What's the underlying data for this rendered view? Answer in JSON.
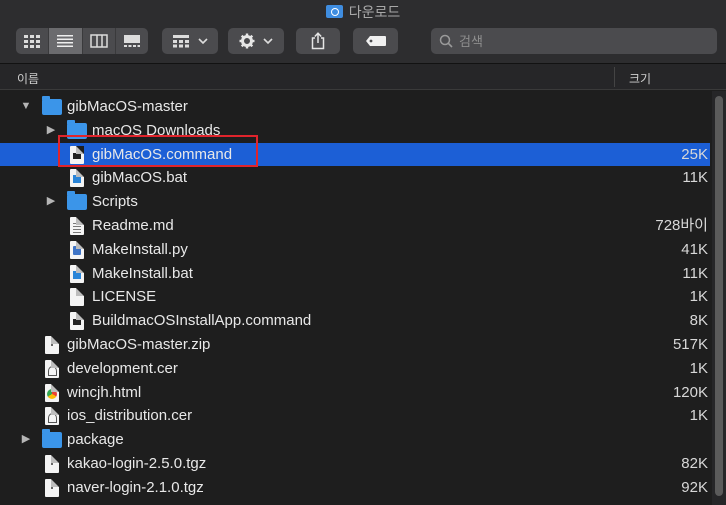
{
  "window": {
    "title": "다운로드",
    "title_icon": "downloads-folder-icon"
  },
  "toolbar": {
    "view_modes": [
      "icon-view-icon",
      "list-view-icon",
      "column-view-icon",
      "gallery-view-icon"
    ],
    "active_view": "list",
    "group_icon": "group-grid-icon",
    "action_icon": "gear-icon",
    "share_icon": "share-icon",
    "tag_icon": "tag-icon",
    "search_placeholder": "검색"
  },
  "columns": {
    "name": "이름",
    "size": "크기"
  },
  "accent_color": "#1c5fd6",
  "highlight_color": "#e0242c",
  "rows": [
    {
      "name": "gibMacOS-master",
      "size": "",
      "kind": "folder",
      "depth": 0,
      "disclosure": "expanded"
    },
    {
      "name": "macOS Downloads",
      "size": "",
      "kind": "folder",
      "depth": 1,
      "disclosure": "collapsed"
    },
    {
      "name": "gibMacOS.command",
      "size": "25K",
      "kind": "command",
      "depth": 1,
      "disclosure": "",
      "selected": true
    },
    {
      "name": "gibMacOS.bat",
      "size": "11K",
      "kind": "bat",
      "depth": 1,
      "disclosure": ""
    },
    {
      "name": "Scripts",
      "size": "",
      "kind": "folder",
      "depth": 1,
      "disclosure": "collapsed"
    },
    {
      "name": "Readme.md",
      "size": "728바이",
      "kind": "text",
      "depth": 1,
      "disclosure": ""
    },
    {
      "name": "MakeInstall.py",
      "size": "41K",
      "kind": "py",
      "depth": 1,
      "disclosure": ""
    },
    {
      "name": "MakeInstall.bat",
      "size": "11K",
      "kind": "bat",
      "depth": 1,
      "disclosure": ""
    },
    {
      "name": "LICENSE",
      "size": "1K",
      "kind": "doc",
      "depth": 1,
      "disclosure": ""
    },
    {
      "name": "BuildmacOSInstallApp.command",
      "size": "8K",
      "kind": "command",
      "depth": 1,
      "disclosure": ""
    },
    {
      "name": "gibMacOS-master.zip",
      "size": "517K",
      "kind": "zip",
      "depth": 0,
      "disclosure": ""
    },
    {
      "name": "development.cer",
      "size": "1K",
      "kind": "cer",
      "depth": 0,
      "disclosure": ""
    },
    {
      "name": "wincjh.html",
      "size": "120K",
      "kind": "html",
      "depth": 0,
      "disclosure": ""
    },
    {
      "name": "ios_distribution.cer",
      "size": "1K",
      "kind": "cer",
      "depth": 0,
      "disclosure": ""
    },
    {
      "name": "package",
      "size": "",
      "kind": "folder",
      "depth": 0,
      "disclosure": "collapsed"
    },
    {
      "name": "kakao-login-2.5.0.tgz",
      "size": "82K",
      "kind": "zip",
      "depth": 0,
      "disclosure": ""
    },
    {
      "name": "naver-login-2.1.0.tgz",
      "size": "92K",
      "kind": "zip",
      "depth": 0,
      "disclosure": ""
    }
  ]
}
